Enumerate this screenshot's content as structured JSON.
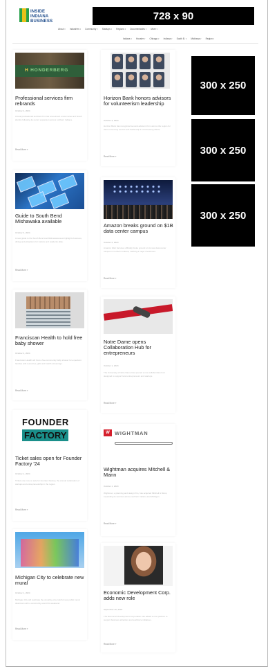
{
  "site": {
    "logo_text": "INSIDE INDIANA BUSINESS",
    "leaderboard_ad": "728 x 90"
  },
  "nav": {
    "primary": [
      "About",
      "Industries",
      "Community",
      "Startups",
      "Regions",
      "Documentaries",
      "More"
    ],
    "secondary": [
      "Indiana",
      "Hoosier",
      "Chicago",
      "Indiana",
      "South B.",
      "Michiana",
      "Region"
    ]
  },
  "ads": {
    "side1": "300 x 250",
    "side2": "300 x 250",
    "side3": "300 x 250"
  },
  "articles": [
    {
      "title": "Professional services firm rebrands",
      "date": "October 4, 2024",
      "excerpt": "A local professional services firm has announced a new name and brand identity following its recent expansion across northern Indiana.",
      "more": "Read More »"
    },
    {
      "title": "Horizon Bank honors advisors for volunteerism leadership",
      "date": "October 3, 2024",
      "excerpt": "Horizon Bank has recognized several advisors from across the region for their community service and leadership in volunteering efforts.",
      "more": "Read More »"
    },
    {
      "title": "Guide to South Bend Mishawaka available",
      "date": "October 3, 2024",
      "excerpt": "A new guide to the South Bend and Mishawaka area highlights business, dining and attractions for visitors and residents alike.",
      "more": "Read More »"
    },
    {
      "title": "Amazon breaks ground on $1B data center campus",
      "date": "October 2, 2024",
      "excerpt": "Amazon Web Services officially broke ground on its new data center campus in northern Indiana, marking a major investment.",
      "more": "Read More »"
    },
    {
      "title": "Franciscan Health to hold free baby shower",
      "date": "October 2, 2024",
      "excerpt": "Franciscan Health will host a free community baby shower for expectant families with resources, gifts and health screenings.",
      "more": "Read More »"
    },
    {
      "title": "Notre Dame opens Collaboration Hub for entrepreneurs",
      "date": "October 1, 2024",
      "excerpt": "The University of Notre Dame has opened a new collaboration hub designed to support local entrepreneurs and startups.",
      "more": "Read More »"
    },
    {
      "title": "Ticket sales open for Founder Factory '24",
      "date": "October 1, 2024",
      "excerpt": "Tickets are now on sale for Founder Factory, the annual celebration of startups and entrepreneurship in the region.",
      "more": "Read More »"
    },
    {
      "title": "Wightman acquires Mitchell & Mann",
      "date": "October 1, 2024",
      "excerpt": "Wightman, a planning and design firm, has acquired Mitchell & Mann, expanding its services across northern Indiana and Michigan.",
      "more": "Read More »"
    },
    {
      "title": "Michigan City to celebrate new mural",
      "date": "October 1, 2024",
      "excerpt": "Michigan City will celebrate the unveiling of a colorful new public mural downtown with a community event this weekend.",
      "more": "Read More »"
    },
    {
      "title": "Economic Development Corp. adds new role",
      "date": "September 30, 2024",
      "excerpt": "The Economic Development Corporation has added a new position to support business attraction and workforce initiatives.",
      "more": "Read More »"
    }
  ]
}
